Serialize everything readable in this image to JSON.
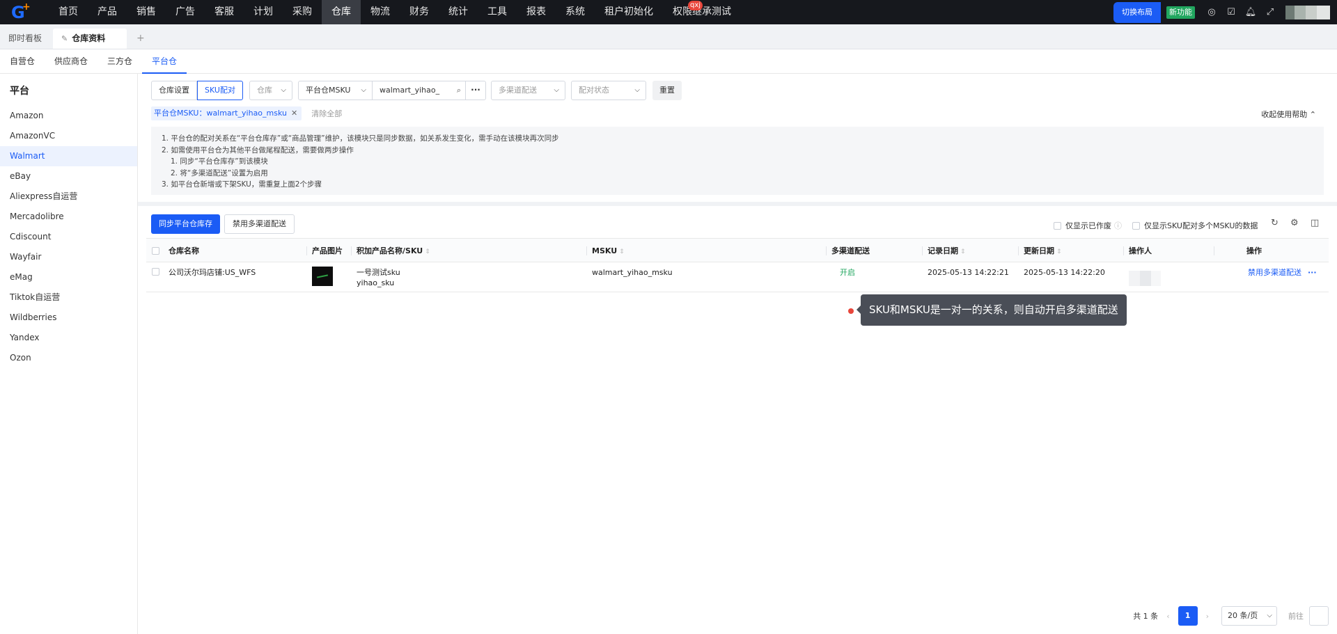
{
  "topnav": {
    "items": [
      "首页",
      "产品",
      "销售",
      "广告",
      "客服",
      "计划",
      "采购",
      "仓库",
      "物流",
      "财务",
      "统计",
      "工具",
      "报表",
      "系统",
      "租户初始化",
      "权限继承测试"
    ],
    "active_index": 7,
    "badge_text": "qxj",
    "switch_layout": "切换布局",
    "new_feature": "新功能"
  },
  "tabs": {
    "dashboard": "即时看板",
    "active": "仓库资料",
    "add": "+"
  },
  "subtabs": [
    "自营仓",
    "供应商仓",
    "三方仓",
    "平台仓"
  ],
  "subtab_active": 3,
  "sidebar": {
    "title": "平台",
    "items": [
      "Amazon",
      "AmazonVC",
      "Walmart",
      "eBay",
      "Aliexpress自运营",
      "Mercadolibre",
      "Cdiscount",
      "Wayfair",
      "eMag",
      "Tiktok自运营",
      "Wildberries",
      "Yandex",
      "Ozon"
    ],
    "active_index": 2
  },
  "filters": {
    "seg_warehouse_settings": "仓库设置",
    "seg_sku_pairing": "SKU配对",
    "warehouse_placeholder": "仓库",
    "field_type": "平台仓MSKU",
    "search_value": "walmart_yihao_",
    "more": "···",
    "multichannel_placeholder": "多渠道配送",
    "pairing_status_placeholder": "配对状态",
    "reset": "重置",
    "active_tag": "平台仓MSKU：walmart_yihao_msku",
    "clear_all": "清除全部",
    "help_toggle": "收起使用帮助"
  },
  "help": {
    "line1": "1. 平台仓的配对关系在“平台仓库存”或“商品管理”维护，该模块只是同步数据，如关系发生变化，需手动在该模块再次同步",
    "line2": "2. 如需使用平台仓为其他平台做尾程配送，需要做两步操作",
    "line3": "1. 同步“平台仓库存”到该模块",
    "line4": "2. 将“多渠道配送”设置为启用",
    "line5": "3. 如平台仓新增或下架SKU，需重复上面2个步骤"
  },
  "toolbar": {
    "sync": "同步平台仓库存",
    "disable": "禁用多渠道配送",
    "only_edited": "仅显示已作废",
    "only_multi": "仅显示SKU配对多个MSKU的数据"
  },
  "table": {
    "headers": {
      "warehouse": "仓库名称",
      "image": "产品图片",
      "product": "积加产品名称/SKU",
      "msku": "MSKU",
      "multichannel": "多渠道配送",
      "record_date": "记录日期",
      "update_date": "更新日期",
      "operator": "操作人",
      "actions": "操作"
    },
    "rows": [
      {
        "warehouse": "公司沃尔玛店铺:US_WFS",
        "product_name": "一号测试sku",
        "sku": "yihao_sku",
        "msku": "walmart_yihao_msku",
        "multichannel": "开启",
        "record_date": "2025-05-13 14:22:21",
        "update_date": "2025-05-13 14:22:20",
        "action": "禁用多渠道配送",
        "more": "···"
      }
    ]
  },
  "tooltip": "SKU和MSKU是一对一的关系，则自动开启多渠道配送",
  "pager": {
    "total": "共 1 条",
    "current": "1",
    "page_size": "20 条/页",
    "goto": "前往"
  }
}
